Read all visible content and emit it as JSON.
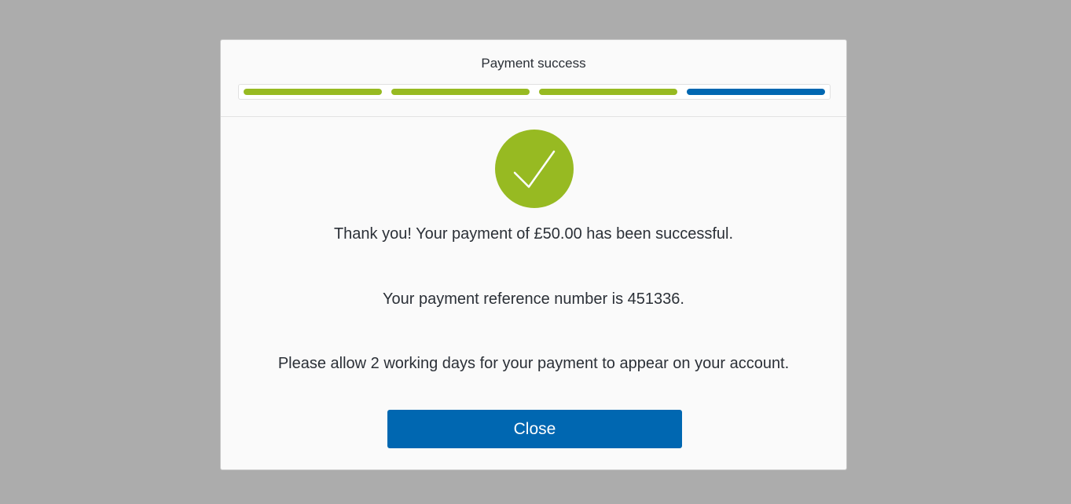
{
  "modal": {
    "title": "Payment success",
    "progress": {
      "steps": [
        {
          "state": "complete",
          "color": "#97ba22"
        },
        {
          "state": "complete",
          "color": "#97ba22"
        },
        {
          "state": "complete",
          "color": "#97ba22"
        },
        {
          "state": "current",
          "color": "#0067b1"
        }
      ]
    },
    "status_icon": "checkmark-circle-icon",
    "status_color": "#97ba22",
    "messages": {
      "thank_you": "Thank you! Your payment of £50.00 has been successful.",
      "reference": "Your payment reference number is 451336.",
      "allow_days": "Please allow 2 working days for your payment to appear on your account."
    },
    "close_label": "Close",
    "close_color": "#0067b1"
  }
}
